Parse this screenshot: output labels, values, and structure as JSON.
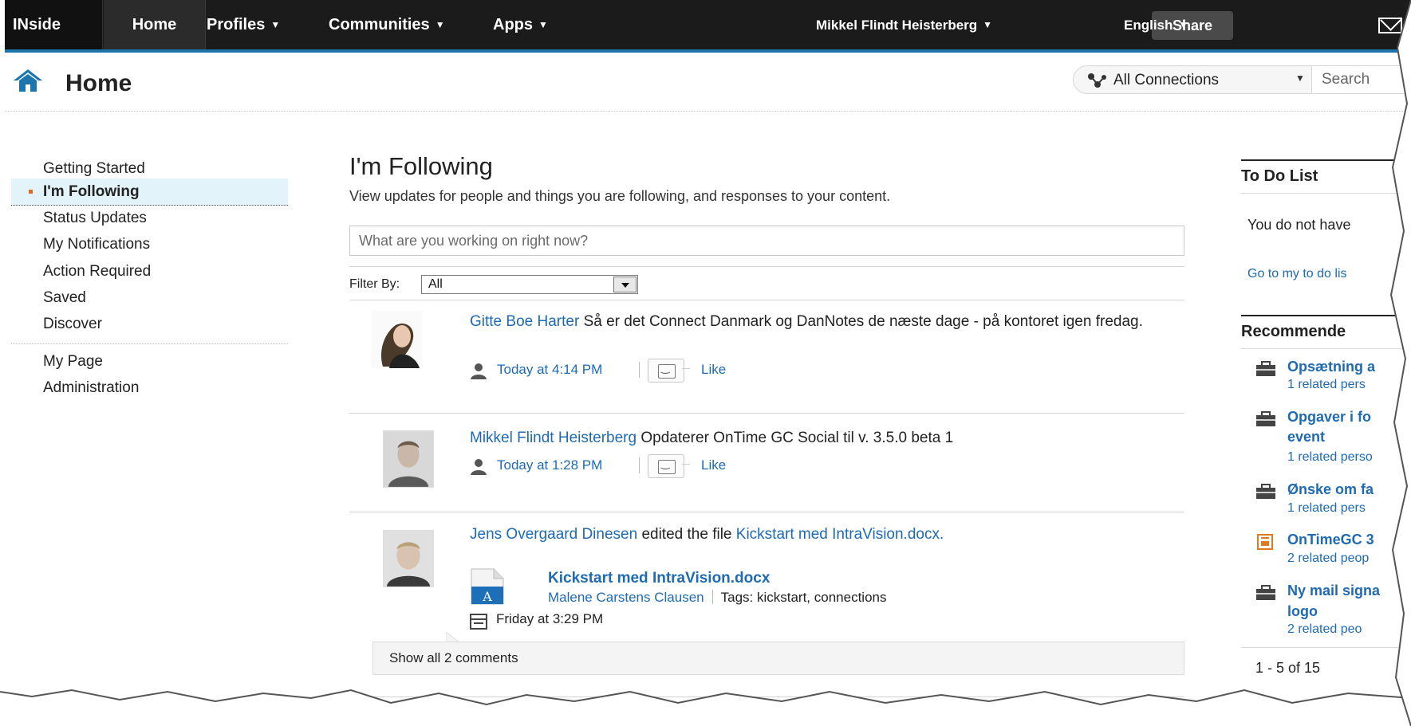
{
  "topnav": {
    "brand": "INside",
    "home": "Home",
    "profiles": "Profiles",
    "communities": "Communities",
    "apps": "Apps",
    "user": "Mikkel Flindt Heisterberg",
    "share": "Share",
    "language": "English"
  },
  "header": {
    "title": "Home",
    "scope": "All Connections",
    "search_placeholder": "Search"
  },
  "leftnav": {
    "getting_started": "Getting Started",
    "im_following": "I'm Following",
    "status_updates": "Status Updates",
    "my_notifications": "My Notifications",
    "action_required": "Action Required",
    "saved": "Saved",
    "discover": "Discover",
    "my_page": "My Page",
    "administration": "Administration"
  },
  "main": {
    "title": "I'm Following",
    "description": "View updates for people and things you are following, and responses to your content.",
    "status_placeholder": "What are you working on right now?",
    "filter_label": "Filter By:",
    "filter_value": "All",
    "entries": [
      {
        "author": "Gitte Boe Harter",
        "text": "Så er det Connect Danmark og DanNotes de næste dage - på kontoret igen fredag.",
        "time": "Today at 4:14 PM",
        "like": "Like"
      },
      {
        "author": "Mikkel Flindt Heisterberg",
        "text": "Opdaterer OnTime GC Social til v. 3.5.0 beta 1",
        "time": "Today at 1:28 PM",
        "like": "Like"
      },
      {
        "author": "Jens Overgaard Dinesen",
        "action": "edited the file",
        "file_link": "Kickstart med IntraVision.docx.",
        "file_title": "Kickstart med IntraVision.docx",
        "file_owner": "Malene Carstens Clausen",
        "tags": "Tags: kickstart, connections",
        "time": "Friday at 3:29 PM",
        "comments": "Show all 2 comments"
      }
    ]
  },
  "right": {
    "todo_title": "To Do List",
    "todo_empty": "You do not have",
    "todo_link": "Go to my to do lis",
    "rec_title": "Recommende",
    "recommendations": [
      {
        "title": "Opsætning a",
        "sub": "1 related pers",
        "icon": "activity-icon"
      },
      {
        "title": "Opgaver i fo",
        "title2": "event",
        "sub": "1 related perso",
        "icon": "activity-icon"
      },
      {
        "title": "Ønske om fa",
        "sub": "1 related pers",
        "icon": "activity-icon"
      },
      {
        "title": "OnTimeGC 3",
        "sub": "2 related peop",
        "icon": "community-icon"
      },
      {
        "title": "Ny mail signa",
        "title2": "logo",
        "sub": "2 related peo",
        "icon": "activity-icon"
      }
    ],
    "pager": "1 - 5 of 15"
  },
  "colors": {
    "topbar": "#1b1b1b",
    "accent": "#1c76ad",
    "link": "#1e6ab3",
    "active_bg": "#e2f3fa",
    "bullet": "#e06b1f"
  }
}
